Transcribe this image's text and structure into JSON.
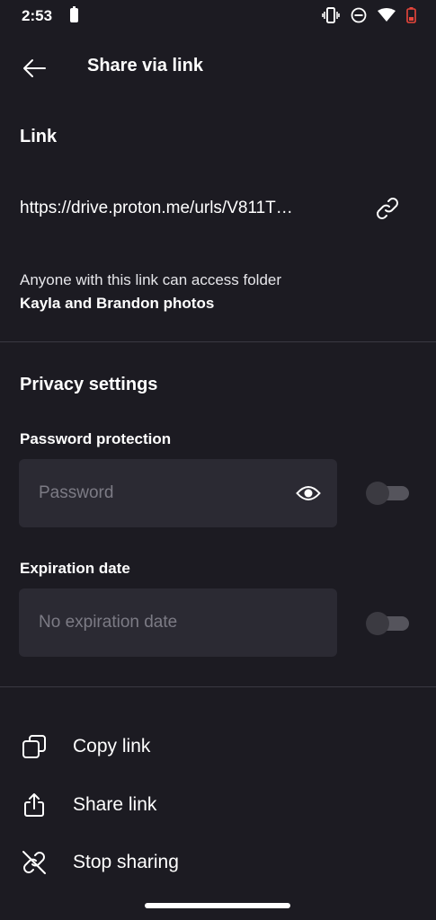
{
  "status_bar": {
    "time": "2:53",
    "icons": [
      "battery-saver-icon",
      "vibrate-icon",
      "do-not-disturb-icon",
      "wifi-icon",
      "battery-low-icon"
    ]
  },
  "appbar": {
    "title": "Share via link",
    "back_icon": "arrow-left-icon"
  },
  "link_section": {
    "heading": "Link",
    "url": "https://drive.proton.me/urls/V811T…",
    "access_text": "Anyone with this link can access folder",
    "folder_name": "Kayla and Brandon photos"
  },
  "privacy": {
    "heading": "Privacy settings",
    "password": {
      "label": "Password protection",
      "placeholder": "Password",
      "value": "",
      "enabled": false
    },
    "expiration": {
      "label": "Expiration date",
      "placeholder": "No expiration date",
      "enabled": false
    }
  },
  "actions": [
    {
      "label": "Copy link",
      "icon": "copy-icon"
    },
    {
      "label": "Share link",
      "icon": "share-icon"
    },
    {
      "label": "Stop sharing",
      "icon": "link-off-icon"
    }
  ],
  "colors": {
    "background": "#1c1b22",
    "input_bg": "#2b2a33",
    "divider": "#3a3942",
    "placeholder": "#7c7b85"
  }
}
